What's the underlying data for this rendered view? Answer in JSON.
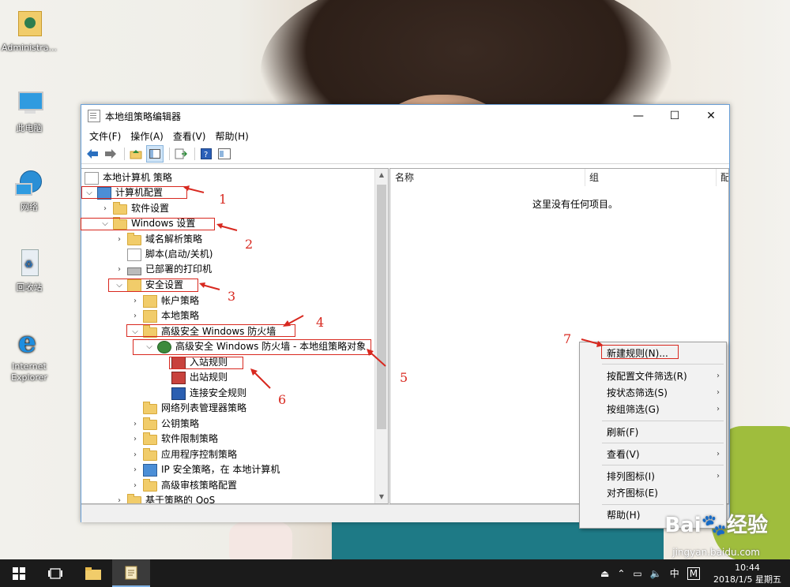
{
  "desktop": {
    "icons": [
      {
        "label": "Administra..."
      },
      {
        "label": "此电脑"
      },
      {
        "label": "网络"
      },
      {
        "label": "回收站"
      },
      {
        "label": "Internet Explorer"
      }
    ]
  },
  "window": {
    "title": "本地组策略编辑器",
    "controls": {
      "minimize": "—",
      "maximize": "☐",
      "close": "✕"
    },
    "menu": [
      "文件(F)",
      "操作(A)",
      "查看(V)",
      "帮助(H)"
    ],
    "tree": {
      "root": "本地计算机 策略",
      "items": [
        {
          "label": "计算机配置"
        },
        {
          "label": "软件设置"
        },
        {
          "label": "Windows 设置"
        },
        {
          "label": "域名解析策略"
        },
        {
          "label": "脚本(启动/关机)"
        },
        {
          "label": "已部署的打印机"
        },
        {
          "label": "安全设置"
        },
        {
          "label": "帐户策略"
        },
        {
          "label": "本地策略"
        },
        {
          "label": "高级安全 Windows 防火墙"
        },
        {
          "label": "高级安全 Windows 防火墙 - 本地组策略对象"
        },
        {
          "label": "入站规则"
        },
        {
          "label": "出站规则"
        },
        {
          "label": "连接安全规则"
        },
        {
          "label": "网络列表管理器策略"
        },
        {
          "label": "公钥策略"
        },
        {
          "label": "软件限制策略"
        },
        {
          "label": "应用程序控制策略"
        },
        {
          "label": "IP 安全策略，在 本地计算机"
        },
        {
          "label": "高级审核策略配置"
        },
        {
          "label": "基于策略的 QoS"
        }
      ]
    },
    "list": {
      "columns": [
        "名称",
        "组",
        "配"
      ],
      "empty_message": "这里没有任何项目。"
    }
  },
  "context_menu": {
    "items": [
      {
        "label": "新建规则(N)..."
      },
      {
        "label": "按配置文件筛选(R)"
      },
      {
        "label": "按状态筛选(S)"
      },
      {
        "label": "按组筛选(G)"
      },
      {
        "label": "刷新(F)"
      },
      {
        "label": "查看(V)"
      },
      {
        "label": "排列图标(I)"
      },
      {
        "label": "对齐图标(E)"
      },
      {
        "label": "帮助(H)"
      }
    ]
  },
  "annotations": [
    "1",
    "2",
    "3",
    "4",
    "5",
    "6",
    "7"
  ],
  "taskbar": {
    "time": "10:44",
    "date": "2018/1/5 星期五",
    "ime": "中",
    "ime_mode": "M"
  },
  "watermark": {
    "brand": "Bai🐾经验",
    "url": "jingyan.baidu.com"
  },
  "colors": {
    "annotation": "#d8281f",
    "taskbar": "#1b1b1b",
    "window_border": "#6aa0d8"
  }
}
